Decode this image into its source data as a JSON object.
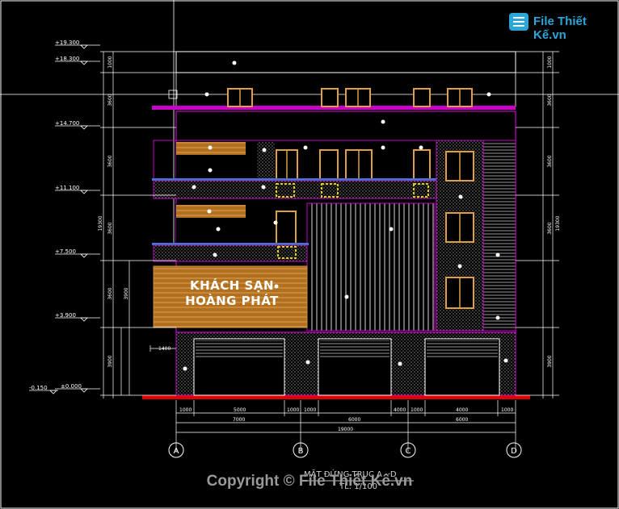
{
  "logo": {
    "text": "File Thiết Kế.vn",
    "icon": "document-logo-icon"
  },
  "sign": {
    "line1": "KHÁCH SẠN",
    "line2": "HOÀNG PHÁT"
  },
  "title": {
    "main": "MẶT ĐỨNG TRỤC A - D",
    "scale": "TL: 1/100"
  },
  "watermark": "Copyright © File Thiết Kế.vn",
  "levels": [
    "+19.300",
    "+18.300",
    "+14.700",
    "+11.100",
    "+7.500",
    "+3.900",
    "±0.000",
    "-0.150"
  ],
  "left_dims": [
    "1000",
    "3600",
    "3600",
    "3600",
    "3600",
    "3900"
  ],
  "left_total": "19300",
  "right_dims": [
    "1000",
    "3600",
    "3600",
    "3600",
    "3900"
  ],
  "right_total": "19300",
  "bottom_dims_row1": [
    "1000",
    "5000",
    "1000",
    "1000",
    "4000",
    "1000",
    "4000",
    "1000"
  ],
  "bottom_dims_row2": [
    "7000",
    "6000",
    "6000"
  ],
  "bottom_total": "19000",
  "small_dim": "1400",
  "axes": [
    "A",
    "B",
    "C",
    "D"
  ],
  "colors": {
    "background": "#000000",
    "wall": "#c800c8",
    "wood": "#c89040",
    "ground": "#e00000",
    "railing": "#3b7bd8",
    "dimension": "#ffffff"
  }
}
